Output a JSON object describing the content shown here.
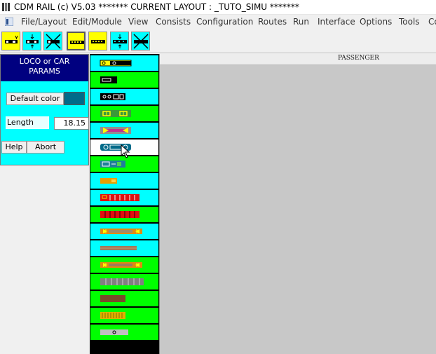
{
  "window": {
    "title": "CDM RAIL (c) V5.03      ******* CURRENT LAYOUT : _TUTO_SIMU *******"
  },
  "menu": {
    "items": [
      "File/Layout",
      "Edit/Module",
      "View",
      "Consists",
      "Configuration",
      "Routes",
      "Run",
      "Interface",
      "Options",
      "Tools",
      "Co"
    ]
  },
  "toolbar": {
    "buttons": [
      {
        "icon": "loco-icon",
        "bg": "#ffff00"
      },
      {
        "icon": "loco-split-icon",
        "bg": "#00ffff"
      },
      {
        "icon": "loco-delete-icon",
        "bg": "#00ffff"
      },
      {
        "icon": "car-icon",
        "bg": "#ffff00",
        "selected": true
      },
      {
        "icon": "car-yellow-icon",
        "bg": "#ffff00"
      },
      {
        "icon": "car-split-icon",
        "bg": "#00ffff"
      },
      {
        "icon": "car-delete-icon",
        "bg": "#00ffff"
      }
    ]
  },
  "params_panel": {
    "title_line1": "LOCO or CAR",
    "title_line2": "PARAMS",
    "default_color_label": "Default color",
    "default_color_value": "#006b8a",
    "length_label": "Length",
    "length_value": "18.15",
    "help_label": "Help",
    "abort_label": "Abort"
  },
  "palette": {
    "items": [
      {
        "bg": "#00ffff",
        "icon": "loco-yellow-black-icon"
      },
      {
        "bg": "#00ff00",
        "icon": "black-box-car-icon"
      },
      {
        "bg": "#00ffff",
        "icon": "black-passenger-car-icon"
      },
      {
        "bg": "#00ff00",
        "icon": "green-yellow-car-icon"
      },
      {
        "bg": "#00ffff",
        "icon": "grey-magenta-car-icon"
      },
      {
        "bg": "#ffffff",
        "icon": "teal-passenger-car-icon",
        "selected": true
      },
      {
        "bg": "#00ff00",
        "icon": "green-teal-car-icon"
      },
      {
        "bg": "#00ffff",
        "icon": "orange-small-car-icon"
      },
      {
        "bg": "#00ffff",
        "icon": "red-windows-car-icon"
      },
      {
        "bg": "#00ff00",
        "icon": "red-coach-icon"
      },
      {
        "bg": "#00ffff",
        "icon": "orange-long-car-icon"
      },
      {
        "bg": "#00ffff",
        "icon": "brown-flat-car-icon"
      },
      {
        "bg": "#00ff00",
        "icon": "orange-brown-car-icon"
      },
      {
        "bg": "#00ff00",
        "icon": "grey-windows-car-icon"
      },
      {
        "bg": "#00ff00",
        "icon": "brown-box-car-icon"
      },
      {
        "bg": "#00ff00",
        "icon": "yellow-ribbed-car-icon"
      },
      {
        "bg": "#00ff00",
        "icon": "grey-small-car-icon"
      }
    ]
  },
  "canvas": {
    "label": "PASSENGER"
  }
}
